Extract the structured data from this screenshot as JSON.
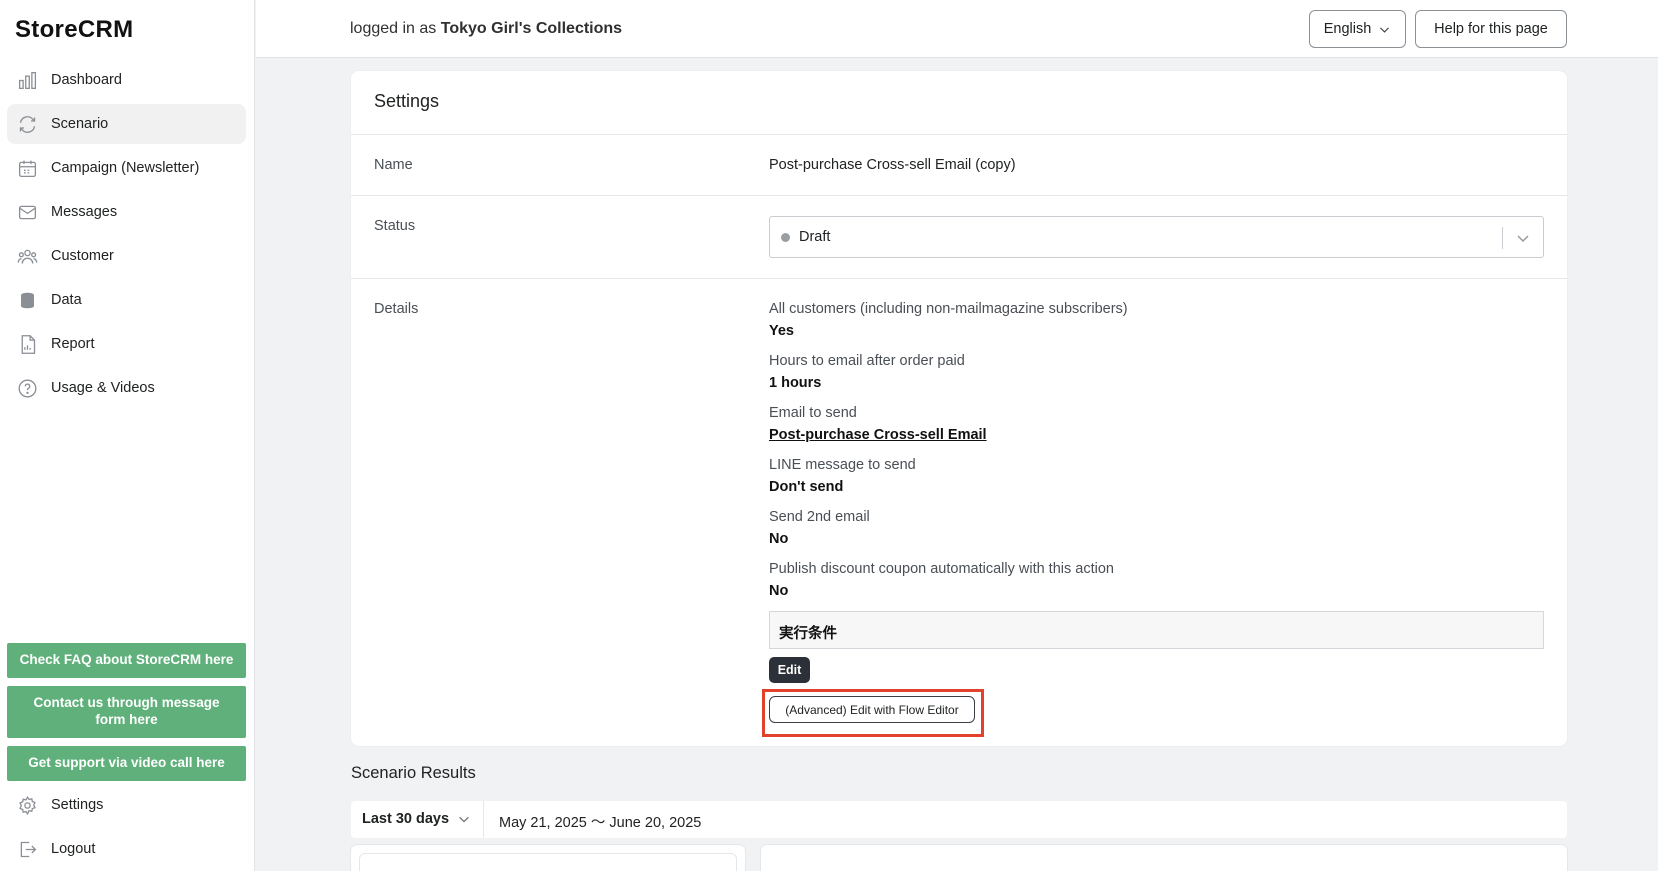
{
  "sidebar": {
    "brand": "StoreCRM",
    "nav": [
      {
        "label": "Dashboard",
        "icon": "bar-chart-icon"
      },
      {
        "label": "Scenario",
        "icon": "refresh-icon"
      },
      {
        "label": "Campaign (Newsletter)",
        "icon": "calendar-icon"
      },
      {
        "label": "Messages",
        "icon": "mail-icon"
      },
      {
        "label": "Customer",
        "icon": "users-icon"
      },
      {
        "label": "Data",
        "icon": "database-icon"
      },
      {
        "label": "Report",
        "icon": "report-icon"
      },
      {
        "label": "Usage & Videos",
        "icon": "help-circle-icon"
      }
    ],
    "support_buttons": [
      "Check FAQ about StoreCRM here",
      "Contact us through message form here",
      "Get support via video call here"
    ],
    "settings_label": "Settings",
    "logout_label": "Logout"
  },
  "topbar": {
    "logged_prefix": "logged in as",
    "store_name": "Tokyo Girl's Collections",
    "language": "English",
    "help_label": "Help for this page"
  },
  "settings": {
    "title": "Settings",
    "name_label": "Name",
    "name_value": "Post-purchase Cross-sell Email (copy)",
    "status_label": "Status",
    "status_value": "Draft",
    "details_label": "Details",
    "details": [
      {
        "label": "All customers (including non-mailmagazine subscribers)",
        "value": "Yes"
      },
      {
        "label": "Hours to email after order paid",
        "value": "1 hours"
      },
      {
        "label": "Email to send",
        "value": "Post-purchase Cross-sell Email"
      },
      {
        "label": "LINE message to send",
        "value": "Don't send"
      },
      {
        "label": "Send 2nd email",
        "value": "No"
      },
      {
        "label": "Publish discount coupon automatically with this action",
        "value": "No"
      }
    ],
    "condition_title": "実行条件",
    "edit_label": "Edit",
    "flow_editor_label": "(Advanced) Edit with Flow Editor"
  },
  "results": {
    "title": "Scenario Results",
    "range_label": "Last 30 days",
    "date_range": "May 21, 2025 〜 June 20, 2025"
  },
  "colors": {
    "accent_green": "#5fb07a",
    "highlight_red": "#e2422b",
    "dark_button": "#2c3038"
  }
}
